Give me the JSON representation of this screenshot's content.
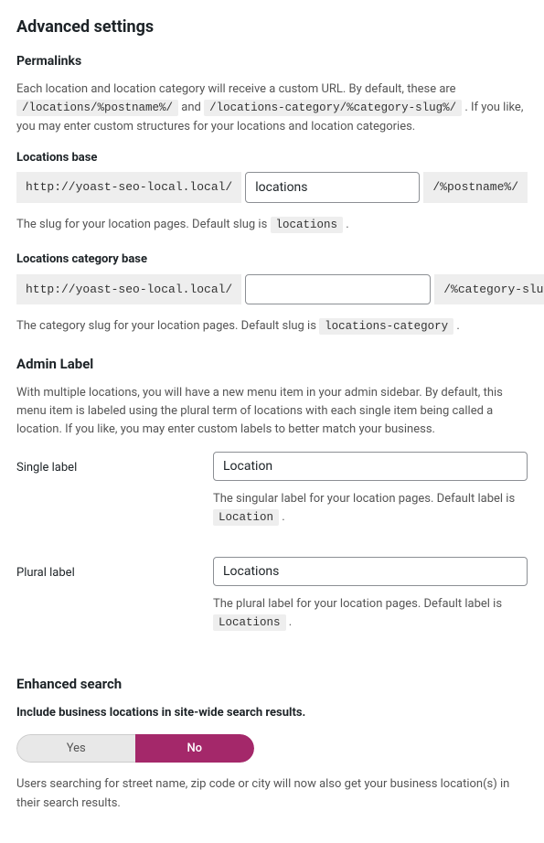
{
  "page": {
    "title": "Advanced settings"
  },
  "permalinks": {
    "heading": "Permalinks",
    "intro_pre": "Each location and location category will receive a custom URL. By default, these are ",
    "code1": "/locations/%postname%/",
    "intro_mid": " and ",
    "code2": "/locations-category/%category-slug%/",
    "intro_post": " . If you like, you may enter custom structures for your locations and location categories.",
    "locations_base": {
      "label": "Locations base",
      "prefix": "http://yoast-seo-local.local/",
      "value": "locations",
      "suffix": "/%postname%/",
      "help_pre": "The slug for your location pages. Default slug is ",
      "help_code": "locations",
      "help_post": " ."
    },
    "category_base": {
      "label": "Locations category base",
      "prefix": "http://yoast-seo-local.local/",
      "value": "",
      "suffix": "/%category-slug%/",
      "help_pre": "The category slug for your location pages. Default slug is ",
      "help_code": "locations-category",
      "help_post": " ."
    }
  },
  "admin_label": {
    "heading": "Admin Label",
    "intro": "With multiple locations, you will have a new menu item in your admin sidebar. By default, this menu item is labeled using the plural term of locations with each single item being called a location. If you like, you may enter custom labels to better match your business.",
    "single": {
      "label": "Single label",
      "value": "Location",
      "help_pre": "The singular label for your location pages. Default label is ",
      "help_code": "Location",
      "help_post": " ."
    },
    "plural": {
      "label": "Plural label",
      "value": "Locations",
      "help_pre": "The plural label for your location pages. Default label is ",
      "help_code": "Locations",
      "help_post": " ."
    }
  },
  "enhanced_search": {
    "heading": "Enhanced search",
    "statement": "Include business locations in site-wide search results.",
    "yes": "Yes",
    "no": "No",
    "help": "Users searching for street name, zip code or city will now also get your business location(s) in their search results."
  }
}
